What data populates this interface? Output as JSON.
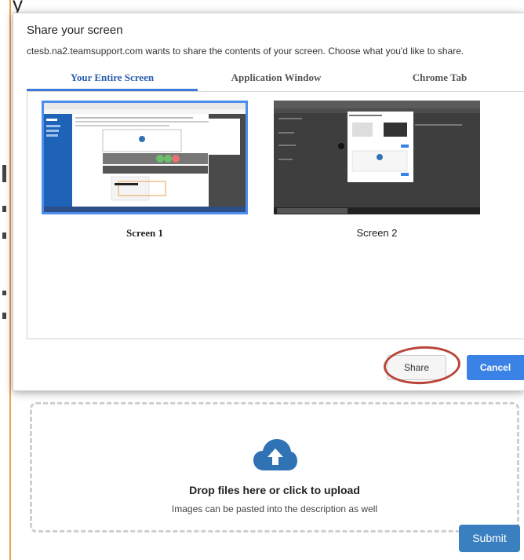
{
  "background_text": "y",
  "dialog": {
    "title": "Share your screen",
    "subtitle": "ctesb.na2.teamsupport.com wants to share the contents of your screen. Choose what you'd like to share.",
    "tabs": [
      {
        "label": "Your Entire Screen",
        "active": true
      },
      {
        "label": "Application Window",
        "active": false
      },
      {
        "label": "Chrome Tab",
        "active": false
      }
    ],
    "screens": [
      {
        "label": "Screen 1",
        "selected": true
      },
      {
        "label": "Screen 2",
        "selected": false
      }
    ],
    "share_label": "Share",
    "cancel_label": "Cancel"
  },
  "dropzone": {
    "icon": "cloud-upload-icon",
    "title": "Drop files here or click to upload",
    "subtitle": "Images can be pasted into the description as well"
  },
  "submit_label": "Submit",
  "colors": {
    "accent": "#3b82e6",
    "tab_active": "#2a5db0",
    "highlight": "#b9463a",
    "submit": "#3a7fbf",
    "cloud": "#2f73b5"
  }
}
